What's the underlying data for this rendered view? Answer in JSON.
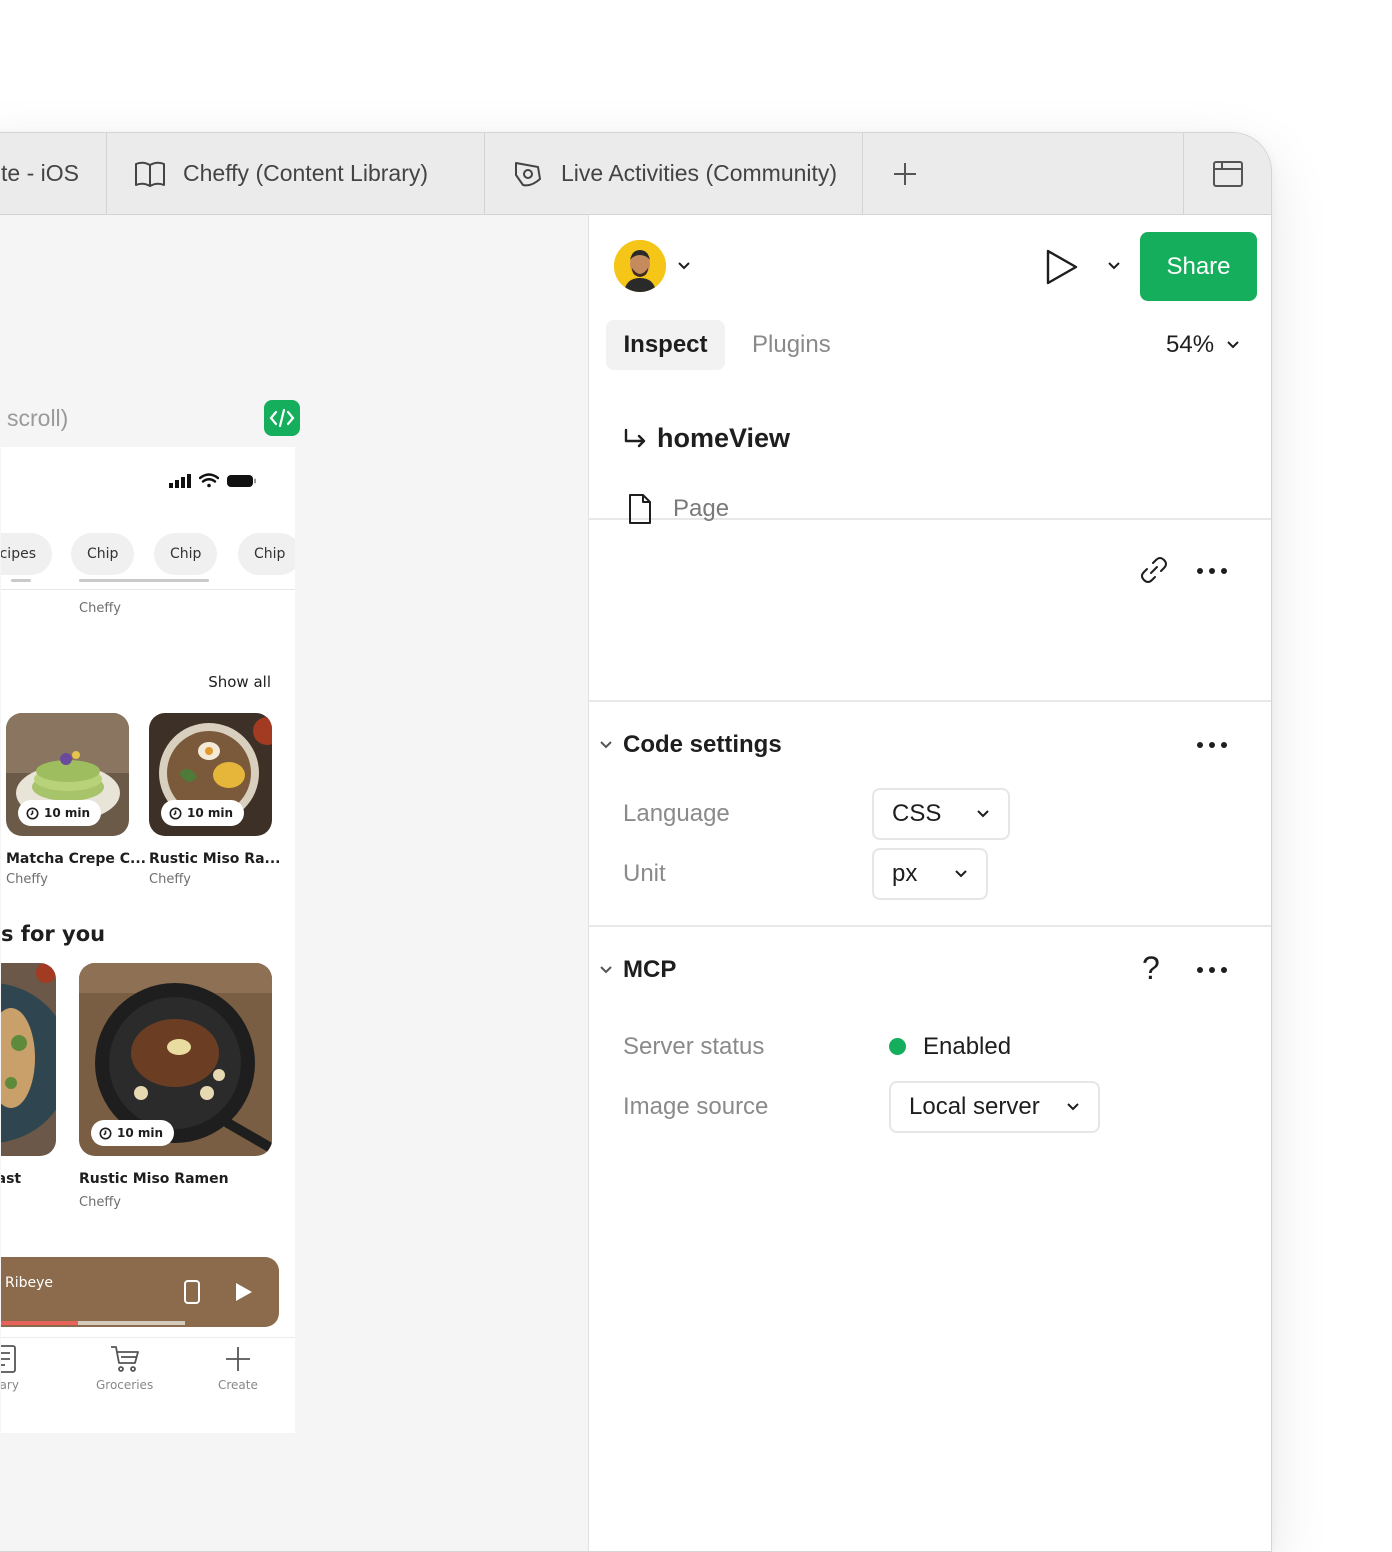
{
  "tabs": [
    {
      "label": "te - iOS"
    },
    {
      "label": "Cheffy (Content Library)"
    },
    {
      "label": "Live Activities (Community)"
    }
  ],
  "canvas": {
    "frame_label": "scroll)",
    "phone": {
      "chips": [
        "ecipes",
        "Chip",
        "Chip",
        "Chip"
      ],
      "top_author": "Cheffy",
      "show_all": "Show all",
      "cards": [
        {
          "title": "Matcha Crepe C...",
          "author": "Cheffy",
          "time": "10 min"
        },
        {
          "title": "Rustic Miso Ra...",
          "author": "Cheffy",
          "time": "10 min"
        }
      ],
      "section_heading": "s for you",
      "big_cards": [
        {
          "title": "oast"
        },
        {
          "title": "Rustic Miso Ramen",
          "author": "Cheffy",
          "time": "10 min"
        }
      ],
      "player": {
        "title": "Ribeye",
        "progress": 0.45
      },
      "nav": [
        {
          "label": "brary",
          "icon": "library-icon"
        },
        {
          "label": "Groceries",
          "icon": "cart-icon"
        },
        {
          "label": "Create",
          "icon": "plus-icon"
        }
      ]
    }
  },
  "panel": {
    "share_label": "Share",
    "tabs": {
      "inspect": "Inspect",
      "plugins": "Plugins"
    },
    "zoom": "54%",
    "layer": {
      "name": "homeView",
      "type": "Page"
    },
    "code_settings": {
      "title": "Code settings",
      "language_label": "Language",
      "language_value": "CSS",
      "unit_label": "Unit",
      "unit_value": "px"
    },
    "mcp": {
      "title": "MCP",
      "help": "?",
      "server_status_label": "Server status",
      "server_status_value": "Enabled",
      "image_source_label": "Image source",
      "image_source_value": "Local server"
    }
  },
  "colors": {
    "accent": "#14ae5c",
    "player": "#8b6b4c",
    "progress": "#e8645a"
  }
}
